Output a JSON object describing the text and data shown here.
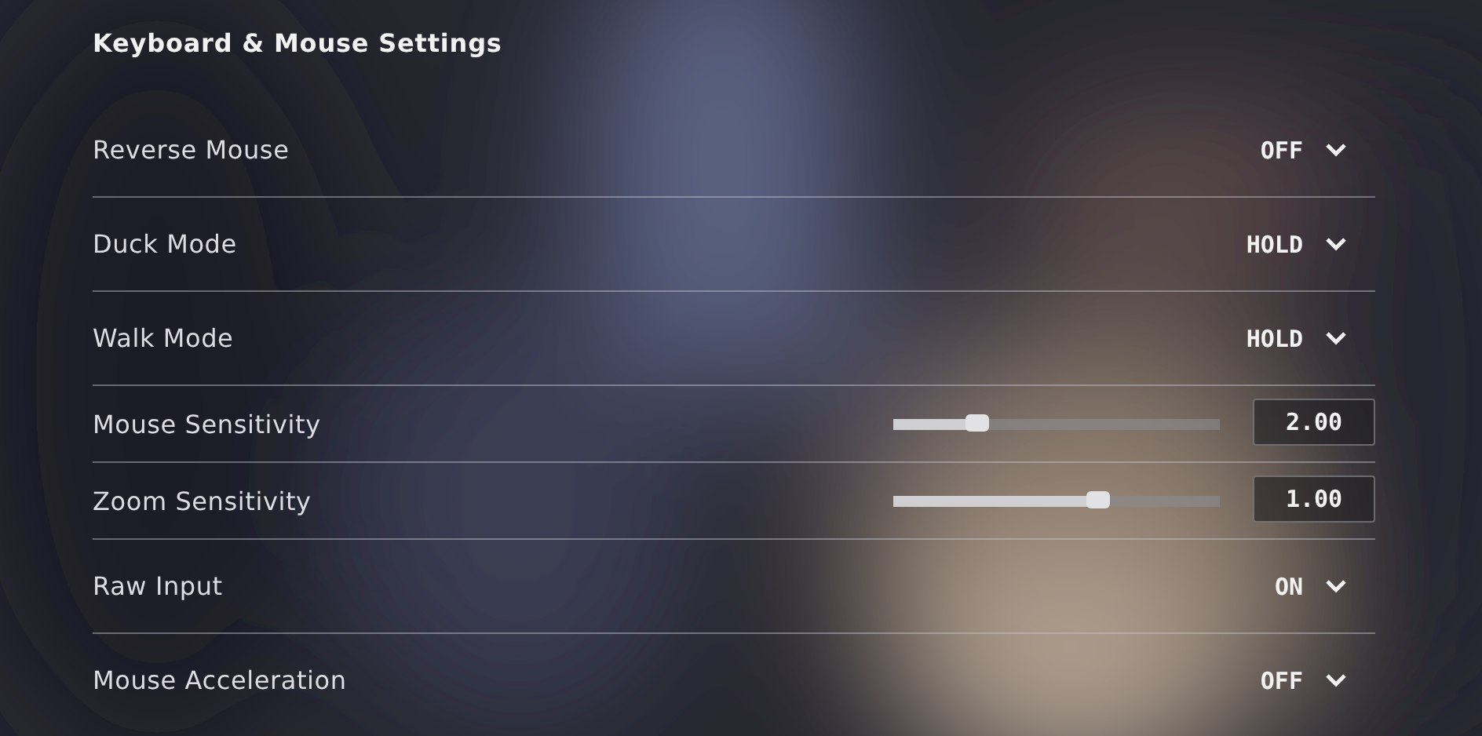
{
  "title": "Keyboard & Mouse Settings",
  "settings": [
    {
      "kind": "dropdown",
      "label": "Reverse Mouse",
      "value": "OFF"
    },
    {
      "kind": "dropdown",
      "label": "Duck Mode",
      "value": "HOLD"
    },
    {
      "kind": "dropdown",
      "label": "Walk Mode",
      "value": "HOLD"
    },
    {
      "kind": "slider",
      "label": "Mouse Sensitivity",
      "level": 0.26,
      "value": "2.00"
    },
    {
      "kind": "slider",
      "label": "Zoom Sensitivity",
      "level": 0.63,
      "value": "1.00"
    },
    {
      "kind": "dropdown",
      "label": "Raw Input",
      "value": "ON"
    },
    {
      "kind": "dropdown",
      "label": "Mouse Acceleration",
      "value": "OFF"
    }
  ]
}
